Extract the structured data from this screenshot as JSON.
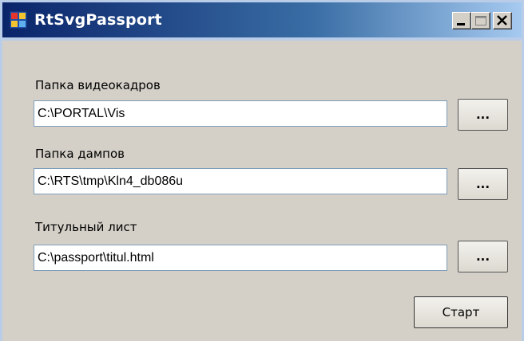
{
  "window": {
    "title": "RtSvgPassport",
    "icon": "app-window-icon"
  },
  "caption_buttons": {
    "minimize": "minimize-icon",
    "maximize": "maximize-icon",
    "close": "close-icon"
  },
  "fields": [
    {
      "label": "Папка видеокадров",
      "value": "C:\\PORTAL\\Vis",
      "browse_label": "..."
    },
    {
      "label": "Папка дампов",
      "value": "C:\\RTS\\tmp\\Kln4_db086u",
      "browse_label": "..."
    },
    {
      "label": "Титульный лист",
      "value": "C:\\passport\\titul.html",
      "browse_label": "..."
    }
  ],
  "start_button": {
    "label": "Старт"
  },
  "colors": {
    "titlebar_start": "#0a246a",
    "titlebar_end": "#a6caf0",
    "window_bg": "#d4d0c8"
  }
}
